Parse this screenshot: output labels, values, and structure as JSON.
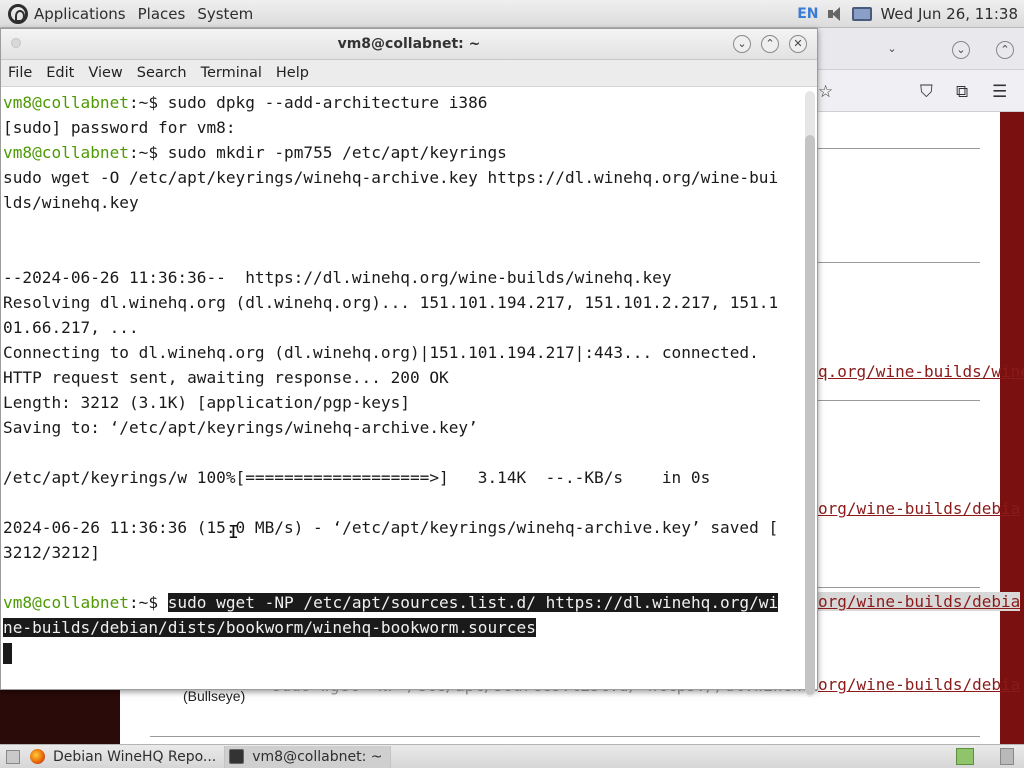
{
  "top_panel": {
    "menus": [
      "Applications",
      "Places",
      "System"
    ],
    "keyboard_layout": "EN",
    "clock": "Wed Jun 26, 11:38"
  },
  "terminal": {
    "title": "vm8@collabnet: ~",
    "menu": [
      "File",
      "Edit",
      "View",
      "Search",
      "Terminal",
      "Help"
    ],
    "prompt": "vm8@collabnet",
    "prompt_suffix": ":~$ ",
    "lines": [
      {
        "type": "prompt",
        "cmd": "sudo dpkg --add-architecture i386"
      },
      {
        "type": "text",
        "text": "[sudo] password for vm8:"
      },
      {
        "type": "prompt",
        "cmd": "sudo mkdir -pm755 /etc/apt/keyrings"
      },
      {
        "type": "text",
        "text": "sudo wget -O /etc/apt/keyrings/winehq-archive.key https://dl.winehq.org/wine-bui"
      },
      {
        "type": "text",
        "text": "lds/winehq.key"
      },
      {
        "type": "text",
        "text": ""
      },
      {
        "type": "text",
        "text": ""
      },
      {
        "type": "text",
        "text": "--2024-06-26 11:36:36--  https://dl.winehq.org/wine-builds/winehq.key"
      },
      {
        "type": "text",
        "text": "Resolving dl.winehq.org (dl.winehq.org)... 151.101.194.217, 151.101.2.217, 151.1"
      },
      {
        "type": "text",
        "text": "01.66.217, ..."
      },
      {
        "type": "text",
        "text": "Connecting to dl.winehq.org (dl.winehq.org)|151.101.194.217|:443... connected."
      },
      {
        "type": "text",
        "text": "HTTP request sent, awaiting response... 200 OK"
      },
      {
        "type": "text",
        "text": "Length: 3212 (3.1K) [application/pgp-keys]"
      },
      {
        "type": "text",
        "text": "Saving to: ‘/etc/apt/keyrings/winehq-archive.key’"
      },
      {
        "type": "text",
        "text": ""
      },
      {
        "type": "text",
        "text": "/etc/apt/keyrings/w 100%[===================>]   3.14K  --.-KB/s    in 0s"
      },
      {
        "type": "text",
        "text": ""
      },
      {
        "type": "text",
        "text": "2024-06-26 11:36:36 (15.0 MB/s) - ‘/etc/apt/keyrings/winehq-archive.key’ saved ["
      },
      {
        "type": "text",
        "text": "3212/3212]"
      },
      {
        "type": "text",
        "text": ""
      },
      {
        "type": "prompt_sel",
        "cmd": "sudo wget -NP /etc/apt/sources.list.d/ https://dl.winehq.org/wi"
      },
      {
        "type": "sel",
        "text": "ne-builds/debian/dists/bookworm/winehq-bookworm.sources"
      },
      {
        "type": "cursor",
        "text": ""
      }
    ]
  },
  "browser": {
    "links": [
      "q.org/wine-builds/wine",
      "org/wine-builds/debia",
      "org/wine-builds/debia",
      "org/wine-builds/debia"
    ],
    "bullseye_label": "(Bullseye)",
    "ghost_cmd": "sudo wget -NP /etc/apt/sources.list.d/ https://dl.winehq."
  },
  "taskbar": {
    "tasks": [
      "Debian WineHQ Repo...",
      "vm8@collabnet: ~"
    ]
  }
}
